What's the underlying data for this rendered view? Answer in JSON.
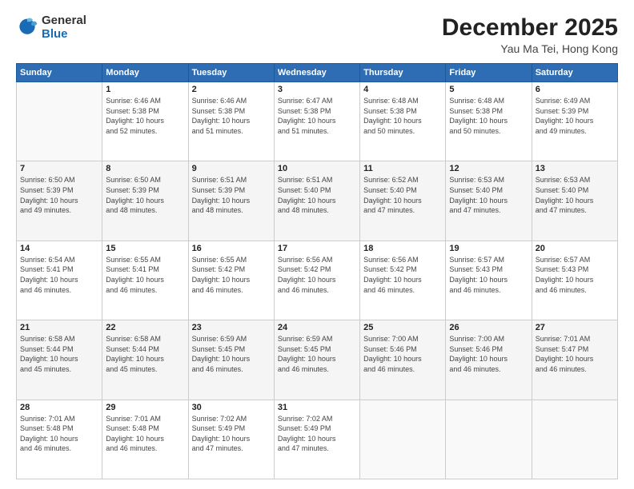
{
  "logo": {
    "general": "General",
    "blue": "Blue"
  },
  "title": {
    "month_year": "December 2025",
    "location": "Yau Ma Tei, Hong Kong"
  },
  "days_of_week": [
    "Sunday",
    "Monday",
    "Tuesday",
    "Wednesday",
    "Thursday",
    "Friday",
    "Saturday"
  ],
  "weeks": [
    [
      {
        "day": "",
        "info": ""
      },
      {
        "day": "1",
        "info": "Sunrise: 6:46 AM\nSunset: 5:38 PM\nDaylight: 10 hours\nand 52 minutes."
      },
      {
        "day": "2",
        "info": "Sunrise: 6:46 AM\nSunset: 5:38 PM\nDaylight: 10 hours\nand 51 minutes."
      },
      {
        "day": "3",
        "info": "Sunrise: 6:47 AM\nSunset: 5:38 PM\nDaylight: 10 hours\nand 51 minutes."
      },
      {
        "day": "4",
        "info": "Sunrise: 6:48 AM\nSunset: 5:38 PM\nDaylight: 10 hours\nand 50 minutes."
      },
      {
        "day": "5",
        "info": "Sunrise: 6:48 AM\nSunset: 5:38 PM\nDaylight: 10 hours\nand 50 minutes."
      },
      {
        "day": "6",
        "info": "Sunrise: 6:49 AM\nSunset: 5:39 PM\nDaylight: 10 hours\nand 49 minutes."
      }
    ],
    [
      {
        "day": "7",
        "info": "Sunrise: 6:50 AM\nSunset: 5:39 PM\nDaylight: 10 hours\nand 49 minutes."
      },
      {
        "day": "8",
        "info": "Sunrise: 6:50 AM\nSunset: 5:39 PM\nDaylight: 10 hours\nand 48 minutes."
      },
      {
        "day": "9",
        "info": "Sunrise: 6:51 AM\nSunset: 5:39 PM\nDaylight: 10 hours\nand 48 minutes."
      },
      {
        "day": "10",
        "info": "Sunrise: 6:51 AM\nSunset: 5:40 PM\nDaylight: 10 hours\nand 48 minutes."
      },
      {
        "day": "11",
        "info": "Sunrise: 6:52 AM\nSunset: 5:40 PM\nDaylight: 10 hours\nand 47 minutes."
      },
      {
        "day": "12",
        "info": "Sunrise: 6:53 AM\nSunset: 5:40 PM\nDaylight: 10 hours\nand 47 minutes."
      },
      {
        "day": "13",
        "info": "Sunrise: 6:53 AM\nSunset: 5:40 PM\nDaylight: 10 hours\nand 47 minutes."
      }
    ],
    [
      {
        "day": "14",
        "info": "Sunrise: 6:54 AM\nSunset: 5:41 PM\nDaylight: 10 hours\nand 46 minutes."
      },
      {
        "day": "15",
        "info": "Sunrise: 6:55 AM\nSunset: 5:41 PM\nDaylight: 10 hours\nand 46 minutes."
      },
      {
        "day": "16",
        "info": "Sunrise: 6:55 AM\nSunset: 5:42 PM\nDaylight: 10 hours\nand 46 minutes."
      },
      {
        "day": "17",
        "info": "Sunrise: 6:56 AM\nSunset: 5:42 PM\nDaylight: 10 hours\nand 46 minutes."
      },
      {
        "day": "18",
        "info": "Sunrise: 6:56 AM\nSunset: 5:42 PM\nDaylight: 10 hours\nand 46 minutes."
      },
      {
        "day": "19",
        "info": "Sunrise: 6:57 AM\nSunset: 5:43 PM\nDaylight: 10 hours\nand 46 minutes."
      },
      {
        "day": "20",
        "info": "Sunrise: 6:57 AM\nSunset: 5:43 PM\nDaylight: 10 hours\nand 46 minutes."
      }
    ],
    [
      {
        "day": "21",
        "info": "Sunrise: 6:58 AM\nSunset: 5:44 PM\nDaylight: 10 hours\nand 45 minutes."
      },
      {
        "day": "22",
        "info": "Sunrise: 6:58 AM\nSunset: 5:44 PM\nDaylight: 10 hours\nand 45 minutes."
      },
      {
        "day": "23",
        "info": "Sunrise: 6:59 AM\nSunset: 5:45 PM\nDaylight: 10 hours\nand 46 minutes."
      },
      {
        "day": "24",
        "info": "Sunrise: 6:59 AM\nSunset: 5:45 PM\nDaylight: 10 hours\nand 46 minutes."
      },
      {
        "day": "25",
        "info": "Sunrise: 7:00 AM\nSunset: 5:46 PM\nDaylight: 10 hours\nand 46 minutes."
      },
      {
        "day": "26",
        "info": "Sunrise: 7:00 AM\nSunset: 5:46 PM\nDaylight: 10 hours\nand 46 minutes."
      },
      {
        "day": "27",
        "info": "Sunrise: 7:01 AM\nSunset: 5:47 PM\nDaylight: 10 hours\nand 46 minutes."
      }
    ],
    [
      {
        "day": "28",
        "info": "Sunrise: 7:01 AM\nSunset: 5:48 PM\nDaylight: 10 hours\nand 46 minutes."
      },
      {
        "day": "29",
        "info": "Sunrise: 7:01 AM\nSunset: 5:48 PM\nDaylight: 10 hours\nand 46 minutes."
      },
      {
        "day": "30",
        "info": "Sunrise: 7:02 AM\nSunset: 5:49 PM\nDaylight: 10 hours\nand 47 minutes."
      },
      {
        "day": "31",
        "info": "Sunrise: 7:02 AM\nSunset: 5:49 PM\nDaylight: 10 hours\nand 47 minutes."
      },
      {
        "day": "",
        "info": ""
      },
      {
        "day": "",
        "info": ""
      },
      {
        "day": "",
        "info": ""
      }
    ]
  ]
}
